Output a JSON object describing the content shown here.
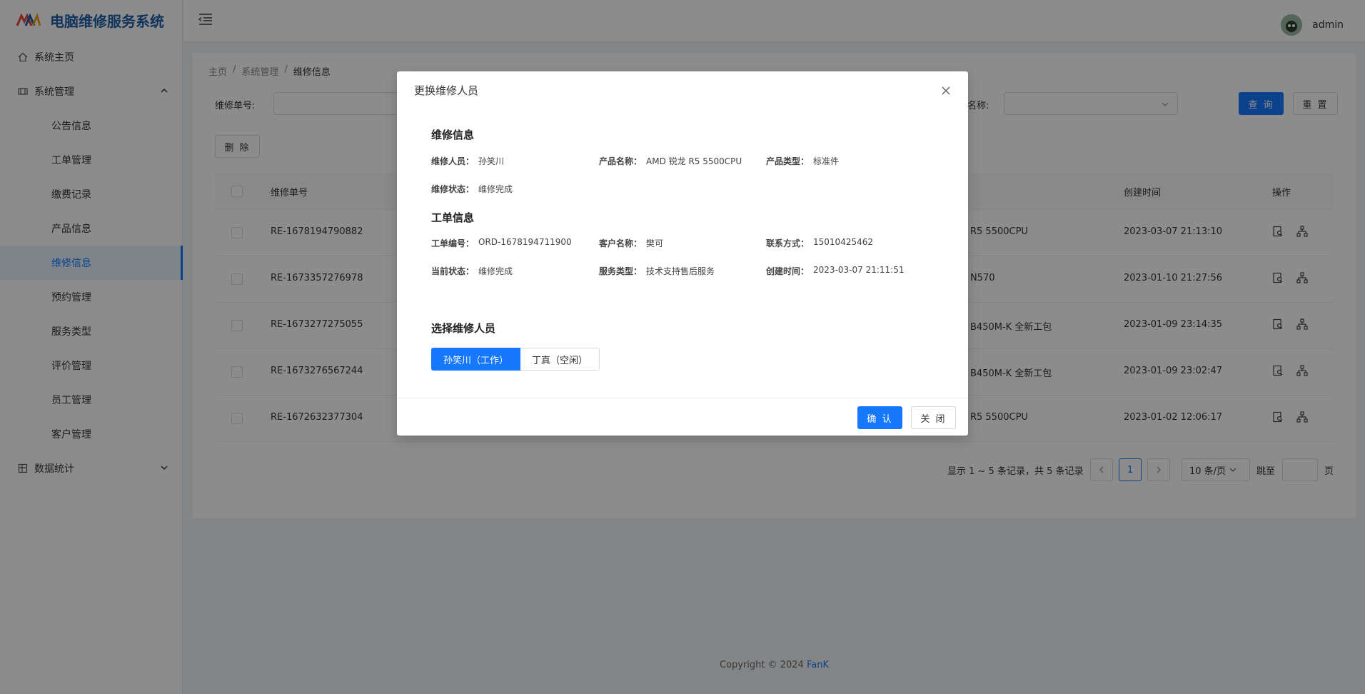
{
  "app": {
    "title": "电脑维修服务系统"
  },
  "sidebar": {
    "items": [
      {
        "label": "系统主页"
      },
      {
        "label": "系统管理"
      },
      {
        "label": "数据统计"
      }
    ],
    "sub_items": [
      {
        "label": "公告信息"
      },
      {
        "label": "工单管理"
      },
      {
        "label": "缴费记录"
      },
      {
        "label": "产品信息"
      },
      {
        "label": "维修信息"
      },
      {
        "label": "预约管理"
      },
      {
        "label": "服务类型"
      },
      {
        "label": "评价管理"
      },
      {
        "label": "员工管理"
      },
      {
        "label": "客户管理"
      }
    ]
  },
  "header": {
    "username": "admin"
  },
  "breadcrumb": {
    "home": "主页",
    "sep": "/",
    "level2": "系统管理",
    "current": "维修信息"
  },
  "search": {
    "order_label": "维修单号:",
    "name_label": "名称:",
    "query_btn": "查 询",
    "reset_btn": "重 置",
    "delete_btn": "删 除"
  },
  "table": {
    "headers": {
      "order_no": "维修单号",
      "created": "创建时间",
      "actions": "操作"
    },
    "rows": [
      {
        "order_no": "RE-1678194790882",
        "product": "R5 5500CPU",
        "created": "2023-03-07 21:13:10"
      },
      {
        "order_no": "RE-1673357276978",
        "product": "N570",
        "created": "2023-01-10 21:27:56"
      },
      {
        "order_no": "RE-1673277275055",
        "product": " B450M-K 全新工包",
        "created": "2023-01-09 23:14:35"
      },
      {
        "order_no": "RE-1673276567244",
        "product": " B450M-K 全新工包",
        "created": "2023-01-09 23:02:47"
      },
      {
        "order_no": "RE-1672632377304",
        "product": "R5 5500CPU",
        "created": "2023-01-02 12:06:17"
      }
    ]
  },
  "pager": {
    "summary": "显示 1 ~ 5 条记录，共 5 条记录",
    "current_page": "1",
    "page_size": "10 条/页",
    "jump_label": "跳至",
    "page_unit": "页"
  },
  "footer": {
    "copyright": "Copyright © 2024 ",
    "brand": "FanK"
  },
  "modal": {
    "title": "更换维修人员",
    "section_repair": "维修信息",
    "repair": {
      "staff_label": "维修人员：",
      "staff": "孙笑川",
      "product_label": "产品名称：",
      "product": "AMD 锐龙 R5 5500CPU",
      "type_label": "产品类型：",
      "type": "标准件",
      "status_label": "维修状态：",
      "status": "维修完成"
    },
    "section_order": "工单信息",
    "order": {
      "no_label": "工单编号：",
      "no": "ORD-1678194711900",
      "customer_label": "客户名称：",
      "customer": "樊可",
      "contact_label": "联系方式：",
      "contact": "15010425462",
      "state_label": "当前状态：",
      "state": "维修完成",
      "service_label": "服务类型：",
      "service": "技术支持售后服务",
      "created_label": "创建时间：",
      "created": "2023-03-07 21:11:51"
    },
    "section_select": "选择维修人员",
    "options": [
      {
        "label": "孙笑川（工作）",
        "selected": true
      },
      {
        "label": "丁真（空闲）",
        "selected": false
      }
    ],
    "confirm_btn": "确 认",
    "close_btn": "关 闭"
  }
}
